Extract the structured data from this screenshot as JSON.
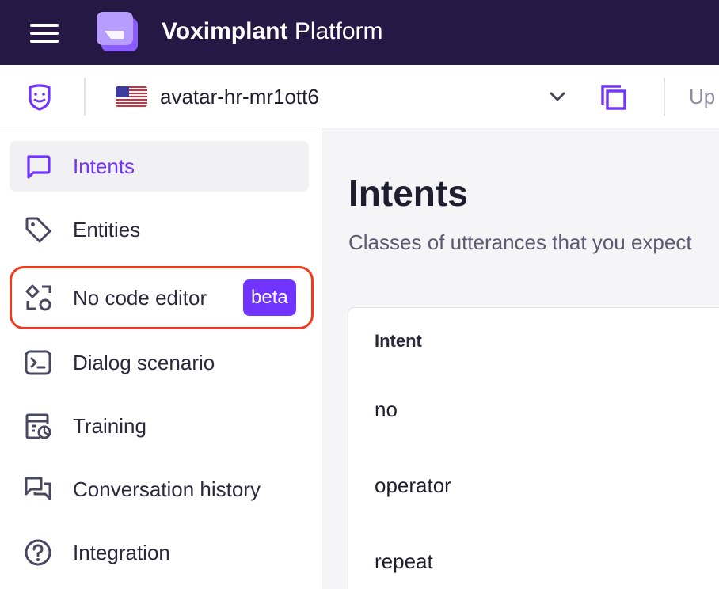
{
  "topbar": {
    "title_bold": "Voximplant",
    "title_light": "Platform",
    "brand_color": "#251844"
  },
  "subheader": {
    "app_name": "avatar-hr-mr1ott6",
    "up_label": "Up",
    "flag": "us-flag-icon"
  },
  "sidebar": {
    "items": [
      {
        "label": "Intents",
        "icon": "chat-bubble-icon",
        "active": true
      },
      {
        "label": "Entities",
        "icon": "tag-icon"
      },
      {
        "label": "No code editor",
        "icon": "shapes-icon",
        "badge": "beta"
      },
      {
        "label": "Dialog scenario",
        "icon": "terminal-icon"
      },
      {
        "label": "Training",
        "icon": "training-icon"
      },
      {
        "label": "Conversation history",
        "icon": "conversation-icon"
      },
      {
        "label": "Integration",
        "icon": "help-circle-icon"
      }
    ]
  },
  "main": {
    "title": "Intents",
    "subtitle": "Classes of utterances that you expect",
    "table": {
      "column_header": "Intent",
      "rows": [
        "no",
        "operator",
        "repeat"
      ]
    }
  },
  "colors": {
    "accent": "#7133ff",
    "highlight": "#ef3b1c"
  }
}
